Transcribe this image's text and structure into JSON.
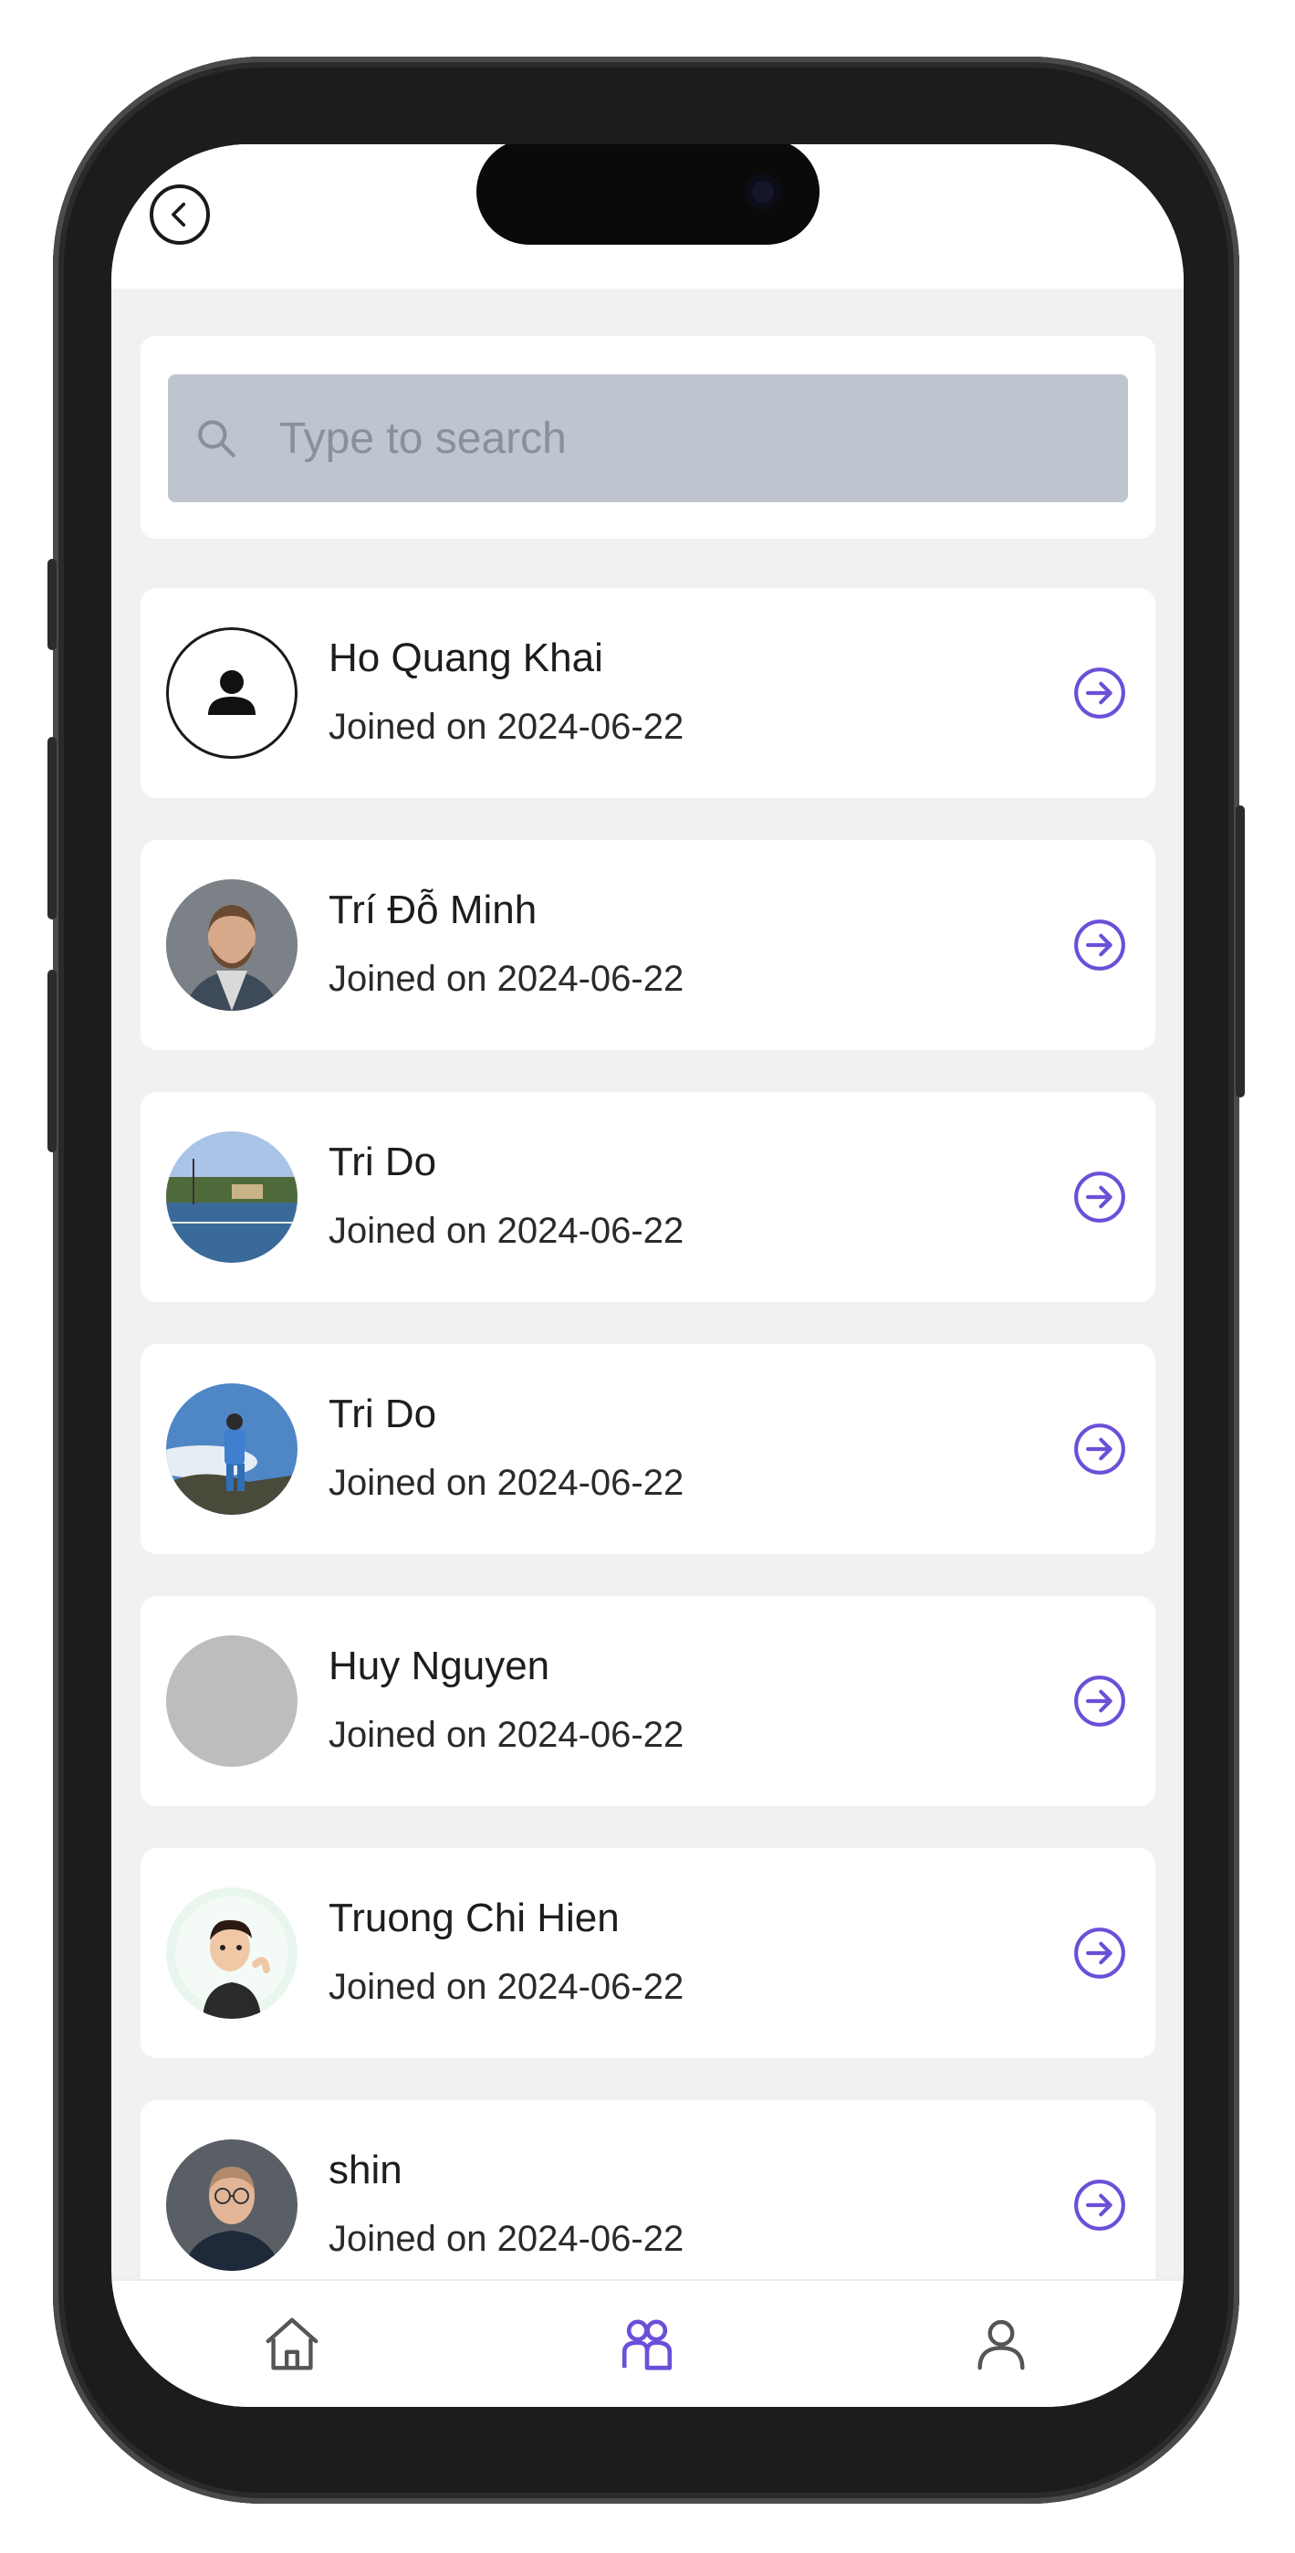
{
  "header": {
    "back_label": "Back"
  },
  "search": {
    "placeholder": "Type to search",
    "value": ""
  },
  "members": [
    {
      "name": "Ho Quang Khai",
      "joined": "Joined on 2024-06-22",
      "avatar": "default-person-icon"
    },
    {
      "name": "Trí Đỗ Minh",
      "joined": "Joined on 2024-06-22",
      "avatar": "photo-bearded-man"
    },
    {
      "name": "Tri Do",
      "joined": "Joined on 2024-06-22",
      "avatar": "photo-tennis-court"
    },
    {
      "name": "Tri Do",
      "joined": "Joined on 2024-06-22",
      "avatar": "photo-mountain-person"
    },
    {
      "name": "Huy Nguyen",
      "joined": "Joined on 2024-06-22",
      "avatar": "gray-placeholder"
    },
    {
      "name": "Truong Chi Hien",
      "joined": "Joined on 2024-06-22",
      "avatar": "cartoon-avatar"
    },
    {
      "name": "shin",
      "joined": "Joined on 2024-06-22",
      "avatar": "photo-man-glasses"
    }
  ],
  "tabbar": {
    "items": [
      {
        "icon": "home-icon",
        "active": false
      },
      {
        "icon": "users-icon",
        "active": true
      },
      {
        "icon": "profile-icon",
        "active": false
      }
    ]
  },
  "colors": {
    "accent": "#6b4fd8",
    "search_bg": "#bfc5cf",
    "page_bg": "#f1f1f1",
    "inactive_icon": "#555555"
  }
}
